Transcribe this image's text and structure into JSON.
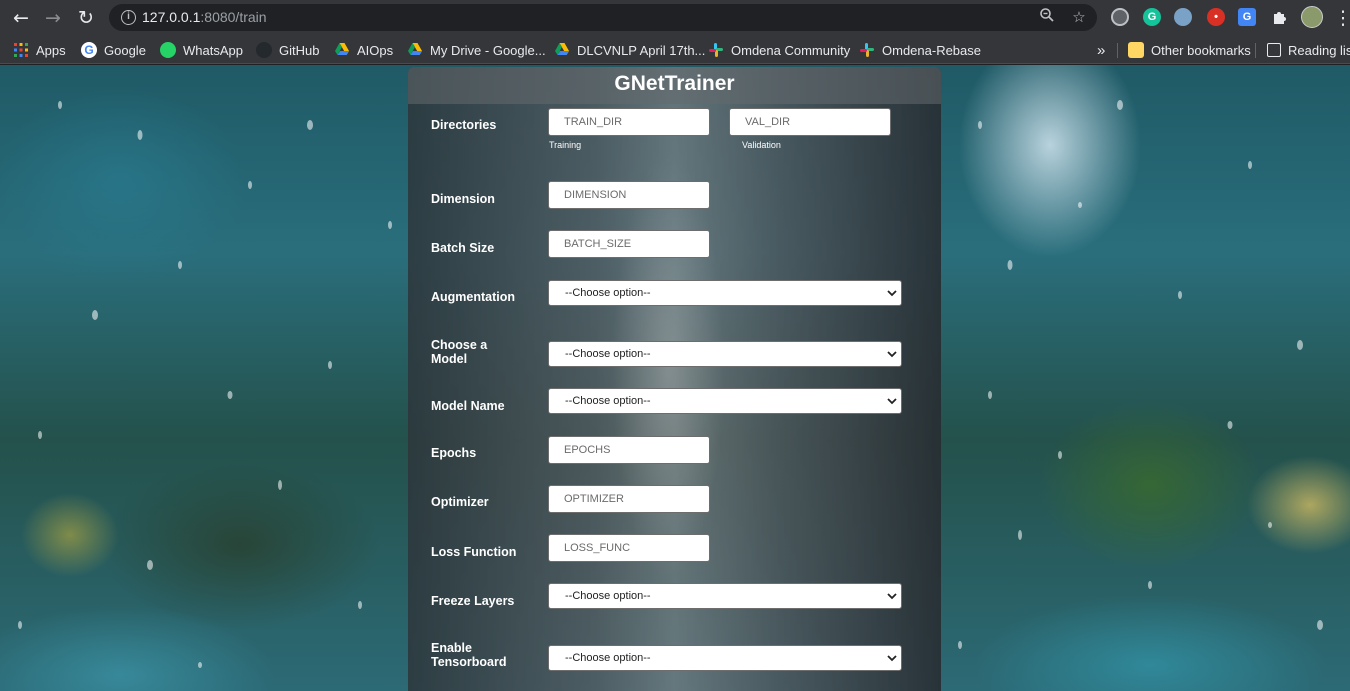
{
  "browser": {
    "url_host": "127.0.0.1",
    "url_rest": ":8080/train",
    "extensions": [
      "chrome-extension-icon",
      "grammarly-icon",
      "eyes-extension-icon",
      "record-icon",
      "google-translate-icon",
      "puzzle-icon",
      "profile-avatar"
    ]
  },
  "bookmarks": {
    "items": [
      {
        "label": "Apps",
        "icon": "apps-grid-icon"
      },
      {
        "label": "Google",
        "icon": "google-icon"
      },
      {
        "label": "WhatsApp",
        "icon": "whatsapp-icon"
      },
      {
        "label": "GitHub",
        "icon": "github-icon"
      },
      {
        "label": "AIOps",
        "icon": "google-drive-icon"
      },
      {
        "label": "My Drive - Google...",
        "icon": "google-drive-icon"
      },
      {
        "label": "DLCVNLP April 17th...",
        "icon": "google-drive-icon"
      },
      {
        "label": "Omdena Community",
        "icon": "slack-icon"
      },
      {
        "label": "Omdena-Rebase",
        "icon": "slack-icon"
      }
    ],
    "overflow": "»",
    "other": "Other bookmarks",
    "reading": "Reading list"
  },
  "form": {
    "title": "GNetTrainer",
    "directories": {
      "label": "Directories",
      "train_placeholder": "TRAIN_DIR",
      "train_hint": "Training",
      "val_placeholder": "VAL_DIR",
      "val_hint": "Validation"
    },
    "dimension": {
      "label": "Dimension",
      "placeholder": "DIMENSION"
    },
    "batch_size": {
      "label": "Batch Size",
      "placeholder": "BATCH_SIZE"
    },
    "augmentation": {
      "label": "Augmentation",
      "value": "--Choose option--"
    },
    "model": {
      "label_line1": "Choose a",
      "label_line2": "Model",
      "value": "--Choose option--"
    },
    "model_name": {
      "label": "Model Name",
      "value": "--Choose option--"
    },
    "epochs": {
      "label": "Epochs",
      "placeholder": "EPOCHS"
    },
    "optimizer": {
      "label": "Optimizer",
      "placeholder": "OPTIMIZER"
    },
    "loss": {
      "label": "Loss Function",
      "placeholder": "LOSS_FUNC"
    },
    "freeze": {
      "label": "Freeze Layers",
      "value": "--Choose option--"
    },
    "tensorboard": {
      "label_line1": "Enable",
      "label_line2": "Tensorboard",
      "value": "--Choose option--"
    }
  }
}
